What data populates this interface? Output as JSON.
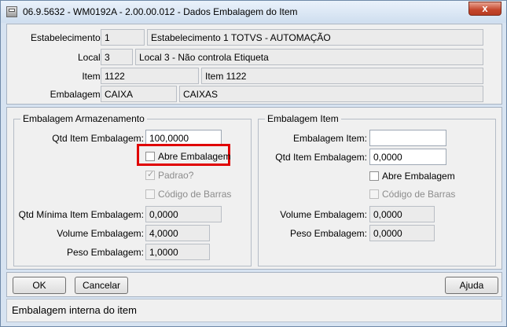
{
  "window": {
    "title": "06.9.5632 - WM0192A - 2.00.00.012 - Dados Embalagem do Item",
    "close_glyph": "x"
  },
  "header": {
    "estabelecimento": {
      "label": "Estabelecimento:",
      "code": "1",
      "description": "Estabelecimento 1 TOTVS - AUTOMAÇÃO"
    },
    "local": {
      "label": "Local:",
      "code": "3",
      "description": "Local 3 - Não controla Etiqueta"
    },
    "item": {
      "label": "Item:",
      "code": "1122",
      "description": "Item 1122"
    },
    "embalagem": {
      "label": "Embalagem:",
      "code": "CAIXA",
      "description": "CAIXAS"
    }
  },
  "armazenamento": {
    "legend": "Embalagem Armazenamento",
    "qtd_label": "Qtd Item Embalagem:",
    "qtd_value": "100,0000",
    "abre_embalagem": {
      "label": "Abre Embalagem",
      "checked": false
    },
    "padrao": {
      "label": "Padrao?",
      "checked": true
    },
    "codigo_barras": {
      "label": "Código de Barras",
      "checked": false
    },
    "qtd_minima_label": "Qtd Mínima Item Embalagem:",
    "qtd_minima_value": "0,0000",
    "volume_label": "Volume Embalagem:",
    "volume_value": "4,0000",
    "peso_label": "Peso Embalagem:",
    "peso_value": "1,0000"
  },
  "item_section": {
    "legend": "Embalagem Item",
    "embalagem_label": "Embalagem Item:",
    "embalagem_value": "",
    "qtd_label": "Qtd Item Embalagem:",
    "qtd_value": "0,0000",
    "abre_embalagem": {
      "label": "Abre Embalagem",
      "checked": false
    },
    "codigo_barras": {
      "label": "Código de Barras",
      "checked": false
    },
    "volume_label": "Volume Embalagem:",
    "volume_value": "0,0000",
    "peso_label": "Peso Embalagem:",
    "peso_value": "0,0000"
  },
  "buttons": {
    "ok": "OK",
    "cancel": "Cancelar",
    "help": "Ajuda"
  },
  "status": {
    "text": "Embalagem interna do item"
  },
  "colors": {
    "highlight": "#e00000",
    "window_frame": "#d7e3f1"
  }
}
